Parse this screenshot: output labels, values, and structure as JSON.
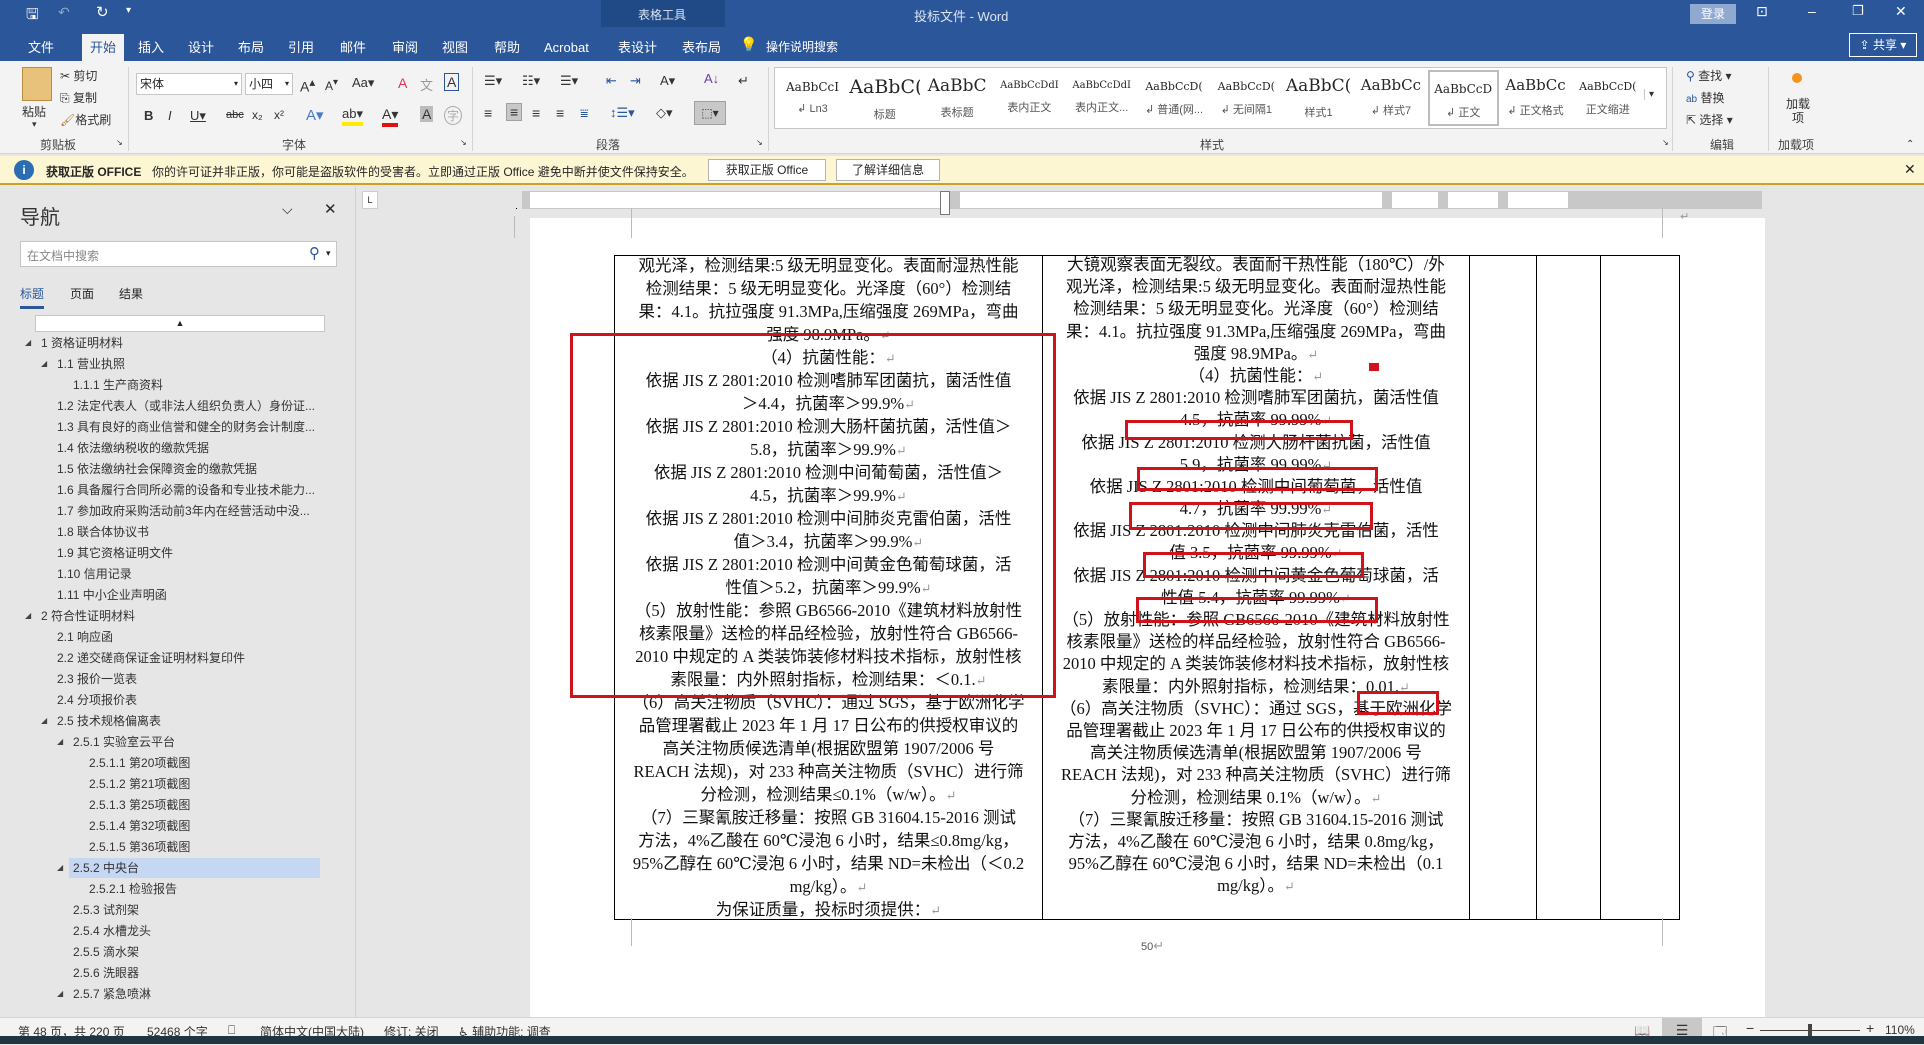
{
  "titlebar": {
    "title": "投标文件 - Word",
    "context_tools": "表格工具",
    "login": "登录",
    "qat_more": "▾"
  },
  "tabs": [
    "文件",
    "开始",
    "插入",
    "设计",
    "布局",
    "引用",
    "邮件",
    "审阅",
    "视图",
    "帮助",
    "Acrobat",
    "表设计",
    "表布局"
  ],
  "tell_me": "操作说明搜索",
  "share": "共享",
  "ribbon": {
    "clipboard": {
      "paste": "粘贴",
      "cut": "剪切",
      "copy": "复制",
      "format_painter": "格式刷",
      "label": "剪贴板"
    },
    "font": {
      "name": "宋体",
      "size": "小四",
      "label": "字体"
    },
    "paragraph": {
      "label": "段落"
    },
    "styles": {
      "label": "样式",
      "items": [
        {
          "preview": "AaBbCcI",
          "name": "↲ Ln3"
        },
        {
          "preview": "AaBbC(",
          "name": "标题"
        },
        {
          "preview": "AaBbC",
          "name": "表标题"
        },
        {
          "preview": "AaBbCcDdI",
          "name": "表内正文"
        },
        {
          "preview": "AaBbCcDdI",
          "name": "表内正文..."
        },
        {
          "preview": "AaBbCcD(",
          "name": "↲ 普通(网..."
        },
        {
          "preview": "AaBbCcD(",
          "name": "↲ 无间隔1"
        },
        {
          "preview": "AaBbC(",
          "name": "样式1"
        },
        {
          "preview": "AaBbCc",
          "name": "↲ 样式7"
        },
        {
          "preview": "AaBbCcD",
          "name": "↲ 正文"
        },
        {
          "preview": "AaBbCc",
          "name": "↲ 正文格式"
        },
        {
          "preview": "AaBbCcD(",
          "name": "正文缩进"
        }
      ]
    },
    "editing": {
      "find": "查找",
      "replace": "替换",
      "select": "选择",
      "label": "编辑"
    },
    "addins": {
      "button": "加载项",
      "label": "加载项"
    }
  },
  "infobar": {
    "title": "获取正版 OFFICE",
    "message": "你的许可证并非正版，你可能是盗版软件的受害者。立即通过正版 Office 避免中断并使文件保持安全。",
    "btn_get": "获取正版 Office",
    "btn_learn": "了解详细信息"
  },
  "nav": {
    "title": "导航",
    "search_placeholder": "在文档中搜索",
    "tabs": [
      "标题",
      "页面",
      "结果"
    ],
    "items": [
      {
        "label": "1 资格证明材料",
        "level": 0,
        "expand": true
      },
      {
        "label": "1.1 营业执照",
        "level": 1,
        "expand": true
      },
      {
        "label": "1.1.1 生产商资料",
        "level": 2
      },
      {
        "label": "1.2 法定代表人（或非法人组织负责人）身份证...",
        "level": 1
      },
      {
        "label": "1.3 具有良好的商业信誉和健全的财务会计制度...",
        "level": 1
      },
      {
        "label": "1.4 依法缴纳税收的缴款凭据",
        "level": 1
      },
      {
        "label": "1.5 依法缴纳社会保障资金的缴款凭据",
        "level": 1
      },
      {
        "label": "1.6 具备履行合同所必需的设备和专业技术能力...",
        "level": 1
      },
      {
        "label": "1.7 参加政府采购活动前3年内在经营活动中没...",
        "level": 1
      },
      {
        "label": "1.8 联合体协议书",
        "level": 1
      },
      {
        "label": "1.9 其它资格证明文件",
        "level": 1
      },
      {
        "label": "1.10 信用记录",
        "level": 1
      },
      {
        "label": "1.11 中小企业声明函",
        "level": 1
      },
      {
        "label": "2 符合性证明材料",
        "level": 0,
        "expand": true
      },
      {
        "label": "2.1 响应函",
        "level": 1
      },
      {
        "label": "2.2 递交磋商保证金证明材料复印件",
        "level": 1
      },
      {
        "label": "2.3 报价一览表",
        "level": 1
      },
      {
        "label": "2.4 分项报价表",
        "level": 1
      },
      {
        "label": "2.5 技术规格偏离表",
        "level": 1,
        "expand": true
      },
      {
        "label": "2.5.1 实验室云平台",
        "level": 2,
        "expand": true
      },
      {
        "label": "2.5.1.1 第20项截图",
        "level": 3
      },
      {
        "label": "2.5.1.2 第21项截图",
        "level": 3
      },
      {
        "label": "2.5.1.3 第25项截图",
        "level": 3
      },
      {
        "label": "2.5.1.4 第32项截图",
        "level": 3
      },
      {
        "label": "2.5.1.5 第36项截图",
        "level": 3
      },
      {
        "label": "2.5.2 中央台",
        "level": 2,
        "expand": true,
        "selected": true
      },
      {
        "label": "2.5.2.1 检验报告",
        "level": 3
      },
      {
        "label": "2.5.3 试剂架",
        "level": 2
      },
      {
        "label": "2.5.4 水槽龙头",
        "level": 2
      },
      {
        "label": "2.5.5 滴水架",
        "level": 2
      },
      {
        "label": "2.5.6 洗眼器",
        "level": 2
      },
      {
        "label": "2.5.7 紧急喷淋",
        "level": 2,
        "expand": true
      }
    ]
  },
  "document": {
    "left_cell": [
      {
        "t": "观光泽，检测结果:5 级无明显变化。表面耐湿热性能"
      },
      {
        "t": "检测结果：5 级无明显变化。光泽度（60°）检测结"
      },
      {
        "t": "果：4.1。抗拉强度 91.3MPa,压缩强度 269MPa，弯曲"
      },
      {
        "t": "强度 98.9MPa。",
        "p": true
      },
      {
        "t": "（4）抗菌性能：",
        "p": true
      },
      {
        "t": "依据 JIS Z 2801:2010 检测嗜肺军团菌抗，菌活性值"
      },
      {
        "t": "＞4.4，抗菌率＞99.9%",
        "p": true
      },
      {
        "t": "依据 JIS Z 2801:2010 检测大肠杆菌抗菌，活性值＞"
      },
      {
        "t": "5.8，抗菌率＞99.9%",
        "p": true
      },
      {
        "t": "依据 JIS Z 2801:2010 检测中间葡萄菌，活性值＞"
      },
      {
        "t": "4.5，抗菌率＞99.9%",
        "p": true
      },
      {
        "t": "依据 JIS Z 2801:2010 检测中间肺炎克雷伯菌，活性"
      },
      {
        "t": "值＞3.4，抗菌率＞99.9%",
        "p": true
      },
      {
        "t": "依据 JIS Z 2801:2010 检测中间黄金色葡萄球菌，活"
      },
      {
        "t": "性值＞5.2，抗菌率＞99.9%",
        "p": true
      },
      {
        "t": "（5）放射性能：参照 GB6566-2010《建筑材料放射性"
      },
      {
        "t": "核素限量》送检的样品经检验，放射性符合 GB6566-"
      },
      {
        "t": "2010 中规定的 A 类装饰装修材料技术指标，放射性核"
      },
      {
        "t": "素限量：内外照射指标，检测结果：＜0.1.",
        "p": true
      },
      {
        "t": "（6）高关注物质（SVHC）：通过 SGS，基于欧洲化学"
      },
      {
        "t": "品管理署截止 2023 年 1 月 17 日公布的供授权审议的"
      },
      {
        "t": "高关注物质候选清单(根据欧盟第 1907/2006 号"
      },
      {
        "t": "REACH 法规)，对 233 种高关注物质（SVHC）进行筛"
      },
      {
        "t": "分检测，检测结果≤0.1%（w/w）。",
        "p": true
      },
      {
        "t": "（7）三聚氰胺迁移量：按照 GB 31604.15-2016 测试"
      },
      {
        "t": "方法，4%乙酸在 60℃浸泡 6 小时，结果≤0.8mg/kg，"
      },
      {
        "t": "95%乙醇在 60℃浸泡 6 小时，结果 ND=未检出（＜0.2"
      },
      {
        "t": "mg/kg）。",
        "p": true
      },
      {
        "t": "为保证质量，投标时须提供：",
        "p": true
      }
    ],
    "right_cell": [
      {
        "t": "大镜观察表面无裂纹。表面耐干热性能（180℃）/外"
      },
      {
        "t": "观光泽，检测结果:5 级无明显变化。表面耐湿热性能"
      },
      {
        "t": "检测结果：5 级无明显变化。光泽度（60°）检测结"
      },
      {
        "t": "果：4.1。抗拉强度 91.3MPa,压缩强度 269MPa，弯曲"
      },
      {
        "t": "强度 98.9MPa。",
        "p": true
      },
      {
        "t": "（4）抗菌性能：",
        "p": true
      },
      {
        "t": "依据 JIS Z 2801:2010 检测嗜肺军团菌抗，菌活性值"
      },
      {
        "t": "4.5，抗菌率 99.99%",
        "p": true
      },
      {
        "t": "依据 JIS Z 2801:2010 检测大肠杆菌抗菌，活性值"
      },
      {
        "t": "5.9，抗菌率 99.99%",
        "p": true
      },
      {
        "t": "依据 JIS Z 2801:2010 检测中间葡萄菌，活性值"
      },
      {
        "t": "4.7，抗菌率 99.99%",
        "p": true
      },
      {
        "t": "依据 JIS Z 2801:2010 检测中间肺炎克雷伯菌，活性"
      },
      {
        "t": "值 3.5，抗菌率 99.99%",
        "p": true
      },
      {
        "t": "依据 JIS Z 2801:2010 检测中间黄金色葡萄球菌，活"
      },
      {
        "t": "性值 5.4，抗菌率 99.99%",
        "p": true
      },
      {
        "t": "（5）放射性能：参照 GB6566-2010《建筑材料放射性"
      },
      {
        "t": "核素限量》送检的样品经检验，放射性符合 GB6566-"
      },
      {
        "t": "2010 中规定的 A 类装饰装修材料技术指标，放射性核"
      },
      {
        "t": "素限量：内外照射指标，检测结果：0.01.",
        "p": true
      },
      {
        "t": "（6）高关注物质（SVHC）：通过 SGS，基于欧洲化学"
      },
      {
        "t": "品管理署截止 2023 年 1 月 17 日公布的供授权审议的"
      },
      {
        "t": "高关注物质候选清单(根据欧盟第 1907/2006 号"
      },
      {
        "t": "REACH 法规)，对 233 种高关注物质（SVHC）进行筛"
      },
      {
        "t": "分检测，检测结果 0.1%（w/w）。",
        "p": true
      },
      {
        "t": "（7）三聚氰胺迁移量：按照 GB 31604.15-2016 测试"
      },
      {
        "t": "方法，4%乙酸在 60℃浸泡 6 小时，结果 0.8mg/kg，"
      },
      {
        "t": "95%乙醇在 60℃浸泡 6 小时，结果 ND=未检出（0.1"
      },
      {
        "t": "mg/kg）。",
        "p": true
      }
    ],
    "page_number": "50"
  },
  "statusbar": {
    "page": "第 48 页，共 220 页",
    "words": "52468 个字",
    "language": "简体中文(中国大陆)",
    "track_changes": "修订: 关闭",
    "accessibility": "辅助功能: 调查",
    "zoom": "110%",
    "zoom_fraction": 0.5
  },
  "colors": {
    "brand": "#2b579a",
    "highlight": "#d0121b",
    "nav_selected": "#c5d7f2"
  }
}
